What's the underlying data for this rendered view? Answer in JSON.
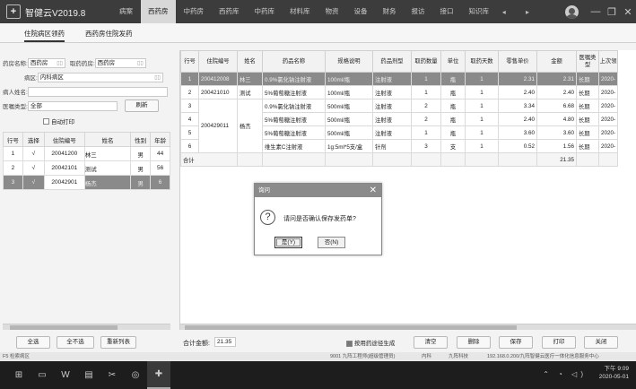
{
  "app": {
    "title": "智健云V2019.8"
  },
  "menu": [
    "病案",
    "西药房",
    "中药房",
    "西药库",
    "中药库",
    "材料库",
    "物资",
    "设备",
    "财务",
    "报访",
    "接口",
    "知识库"
  ],
  "window_controls": {
    "nav": "◂ ▸",
    "minimize": "—",
    "restore": "❐",
    "close": "✕"
  },
  "subtabs": [
    "住院病区领药",
    "西药房住院发药"
  ],
  "filters": {
    "pharmacy_label": "药房名称:",
    "pharmacy_value": "西药房",
    "dispense_label": "取药药房:",
    "dispense_value": "西药房",
    "ward_label": "病区:",
    "ward_value": "内科病区",
    "patient_label": "病人姓名:",
    "patient_value": "",
    "type_label": "医嘱类型:",
    "type_value": "全部",
    "refresh_label": "刷新",
    "autoprint_label": "自动打印",
    "dd_glyph": "▯▯"
  },
  "patients": {
    "headers": [
      "行号",
      "选择",
      "住院编号",
      "姓名",
      "性别",
      "年龄"
    ],
    "rows": [
      [
        "1",
        "√",
        "20041200",
        "林三",
        "男",
        "44"
      ],
      [
        "2",
        "√",
        "20042101",
        "测试",
        "男",
        "56"
      ],
      [
        "3",
        "√",
        "20042901",
        "杨杰",
        "男",
        "6"
      ]
    ]
  },
  "grid": {
    "headers": [
      "行号",
      "住院编号",
      "姓名",
      "药品名称",
      "规格说明",
      "药品剂型",
      "取药数量",
      "单位",
      "取药天数",
      "零售单价",
      "金额",
      "医嘱类型",
      "上次领"
    ],
    "rows": [
      {
        "no": "1",
        "id": "200412008",
        "name": "林三",
        "drug": "0.9%氯化钠注射液",
        "spec": "100ml/瓶",
        "form": "注射液",
        "qty": "1",
        "unit": "瓶",
        "days": "1",
        "price": "2.31",
        "amount": "2.31",
        "otype": "长期",
        "last": "2020-"
      },
      {
        "no": "2",
        "id": "200421010",
        "name": "测试",
        "drug": "5%葡萄糖注射液",
        "spec": "100ml/瓶",
        "form": "注射液",
        "qty": "1",
        "unit": "瓶",
        "days": "1",
        "price": "2.40",
        "amount": "2.40",
        "otype": "长期",
        "last": "2020-"
      },
      {
        "no": "3",
        "id": "",
        "name": "",
        "drug": "0.9%氯化钠注射液",
        "spec": "500ml/瓶",
        "form": "注射液",
        "qty": "2",
        "unit": "瓶",
        "days": "1",
        "price": "3.34",
        "amount": "6.68",
        "otype": "长期",
        "last": "2020-"
      },
      {
        "no": "4",
        "id": "",
        "name": "",
        "drug": "5%葡萄糖注射液",
        "spec": "500ml/瓶",
        "form": "注射液",
        "qty": "2",
        "unit": "瓶",
        "days": "1",
        "price": "2.40",
        "amount": "4.80",
        "otype": "长期",
        "last": "2020-"
      },
      {
        "no": "5",
        "id": "",
        "name": "",
        "drug": "5%葡萄糖注射液",
        "spec": "500ml/瓶",
        "form": "注射液",
        "qty": "1",
        "unit": "瓶",
        "days": "1",
        "price": "3.60",
        "amount": "3.60",
        "otype": "长期",
        "last": "2020-"
      },
      {
        "no": "6",
        "id": "",
        "name": "",
        "drug": "维生素C注射液",
        "spec": "1g:5ml*5支/盒",
        "form": "针剂",
        "qty": "3",
        "unit": "支",
        "days": "1",
        "price": "0.52",
        "amount": "1.56",
        "otype": "长期",
        "last": "2020-"
      }
    ],
    "merged_id": "200429011",
    "merged_name": "杨杰",
    "total_label": "合计",
    "total_amount": "21.35"
  },
  "dialog": {
    "title": "询问",
    "message": "请问是否确认保存发药单?",
    "yes": "是(Y)",
    "no": "否(N)",
    "close": "✕",
    "q": "?"
  },
  "bottom": {
    "select_all": "全选",
    "select_none": "全不选",
    "reverse": "重新列表",
    "total_label": "合计金额:",
    "total_value": "21.35",
    "auto_gen": "按用药途径生成",
    "clear": "清空",
    "delete": "删除",
    "save": "保存",
    "print": "打印",
    "close": "关闭"
  },
  "status": {
    "left": "F5 检索病区",
    "center": "9001 九阵工程师(超级管理员)",
    "dept": "内科",
    "company": "九阵科技",
    "server": "192.168.0.200/九阵智健云医疗一体化信息服务中心"
  },
  "taskbar": {
    "time": "下午 9:09",
    "date": "2020-05-01",
    "tray": "⌃ ◔ ◁)"
  }
}
